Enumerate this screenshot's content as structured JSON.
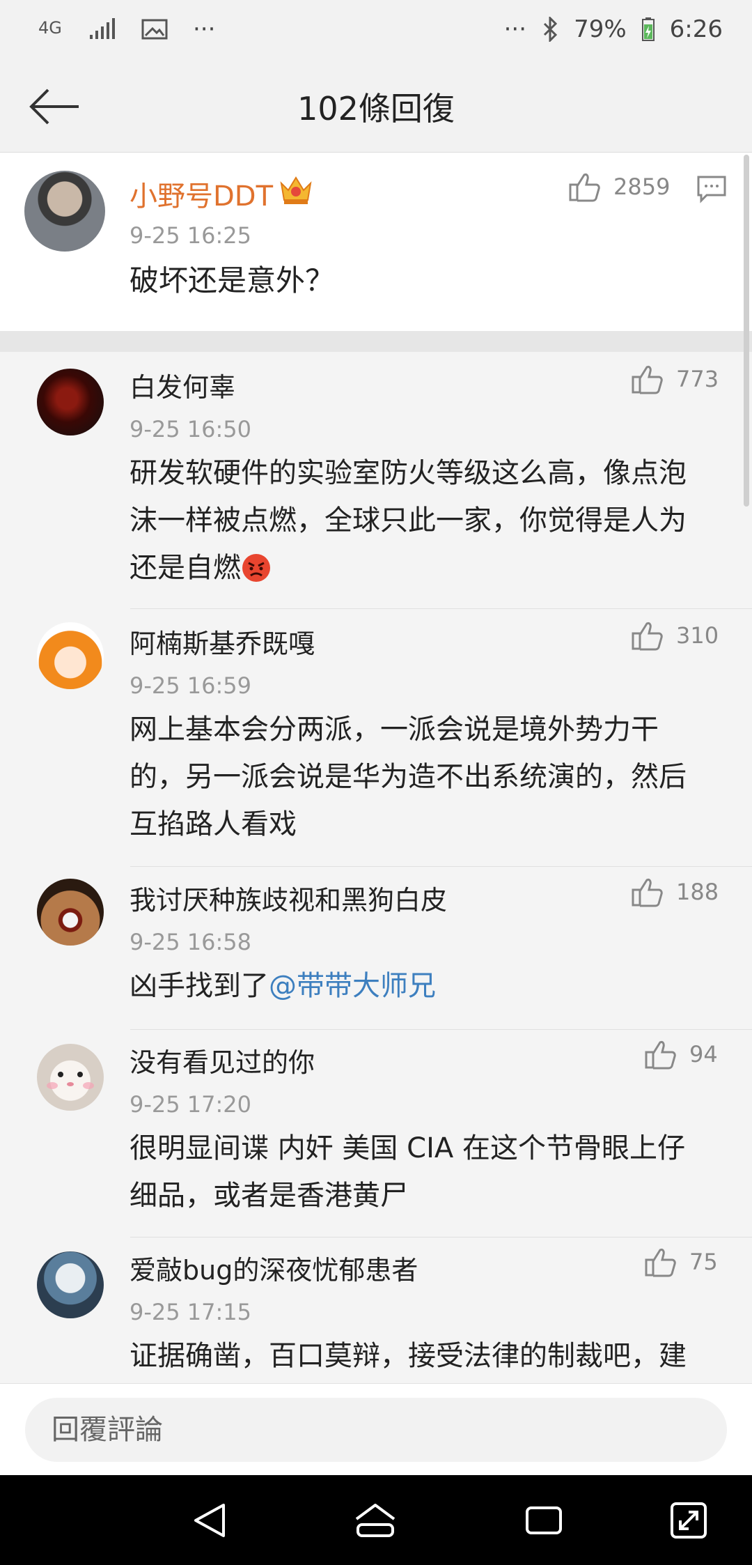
{
  "status_bar": {
    "network": "4G",
    "dots_left": "···",
    "dots_right": "···",
    "battery": "79%",
    "time": "6:26"
  },
  "header": {
    "title": "102條回復",
    "back_icon": "back-arrow-icon"
  },
  "main_comment": {
    "username": "小野号DDT",
    "badge_icon": "vip-crown-icon",
    "time": "9-25 16:25",
    "text": "破坏还是意外？",
    "likes": "2859",
    "username_color": "#e0722e"
  },
  "replies": [
    {
      "username": "白发何辜",
      "time": "9-25 16:50",
      "likes": "773",
      "lines": [
        "研发软硬件的实验室防火等级这么高，像点泡",
        "沫一样被点燃，全球只此一家，你觉得是人为",
        "还是自燃"
      ],
      "emoji": "angry-face-emoji"
    },
    {
      "username": "阿楠斯基乔既嘎",
      "time": "9-25 16:59",
      "likes": "310",
      "lines": [
        "网上基本会分两派，一派会说是境外势力干",
        "的，另一派会说是华为造不出系统演的，然后",
        "互掐路人看戏"
      ]
    },
    {
      "username": "我讨厌种族歧视和黑狗白皮",
      "time": "9-25 16:58",
      "likes": "188",
      "text_prefix": "凶手找到了",
      "mention": "@带带大师兄"
    },
    {
      "username": "没有看见过的你",
      "time": "9-25 17:20",
      "likes": "94",
      "lines": [
        "很明显间谍 内奸 美国 CIA 在这个节骨眼上仔",
        "细品，或者是香港黄尸"
      ]
    },
    {
      "username": "爱敲bug的深夜忧郁患者",
      "time": "9-25 17:15",
      "likes": "75",
      "lines": [
        "证据确凿，百口莫辩，接受法律的制裁吧，建"
      ]
    }
  ],
  "reply_input": {
    "placeholder": "回覆評論"
  },
  "colors": {
    "mention": "#3d7fbf",
    "accent": "#e0722e"
  }
}
